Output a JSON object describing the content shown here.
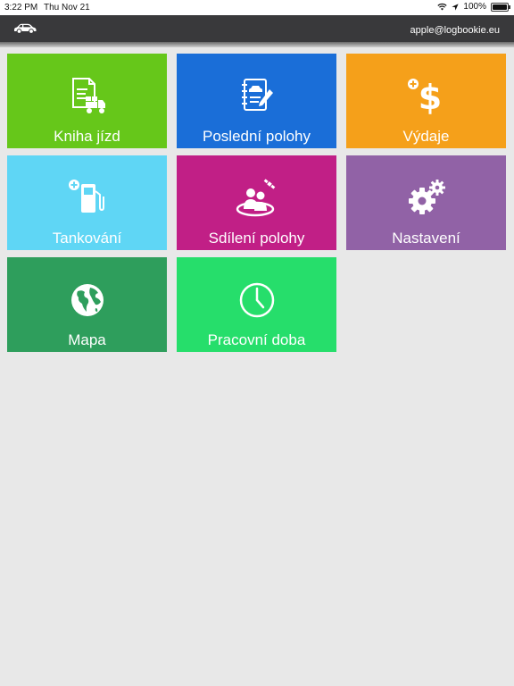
{
  "status_bar": {
    "time": "3:22 PM",
    "date": "Thu Nov 21",
    "battery": "100%",
    "icons": [
      "wifi-icon",
      "location-arrow-icon",
      "battery-icon"
    ]
  },
  "header": {
    "icon": "car-icon",
    "account_email": "apple@logbookie.eu"
  },
  "tiles": [
    {
      "label": "Kniha jízd",
      "icon": "logbook-truck-icon",
      "color": "#66c71a"
    },
    {
      "label": "Poslední polohy",
      "icon": "notebook-car-icon",
      "color": "#1a6ed8"
    },
    {
      "label": "Výdaje",
      "icon": "dollar-plus-icon",
      "color": "#f5a01a"
    },
    {
      "label": "Tankování",
      "icon": "fuel-pump-plus-icon",
      "color": "#5fd6f5"
    },
    {
      "label": "Sdílení polohy",
      "icon": "users-satellite-icon",
      "color": "#c11f86"
    },
    {
      "label": "Nastavení",
      "icon": "gears-icon",
      "color": "#9162a6"
    },
    {
      "label": "Mapa",
      "icon": "globe-icon",
      "color": "#2e9e5c"
    },
    {
      "label": "Pracovní doba",
      "icon": "clock-icon",
      "color": "#26de6b"
    }
  ]
}
